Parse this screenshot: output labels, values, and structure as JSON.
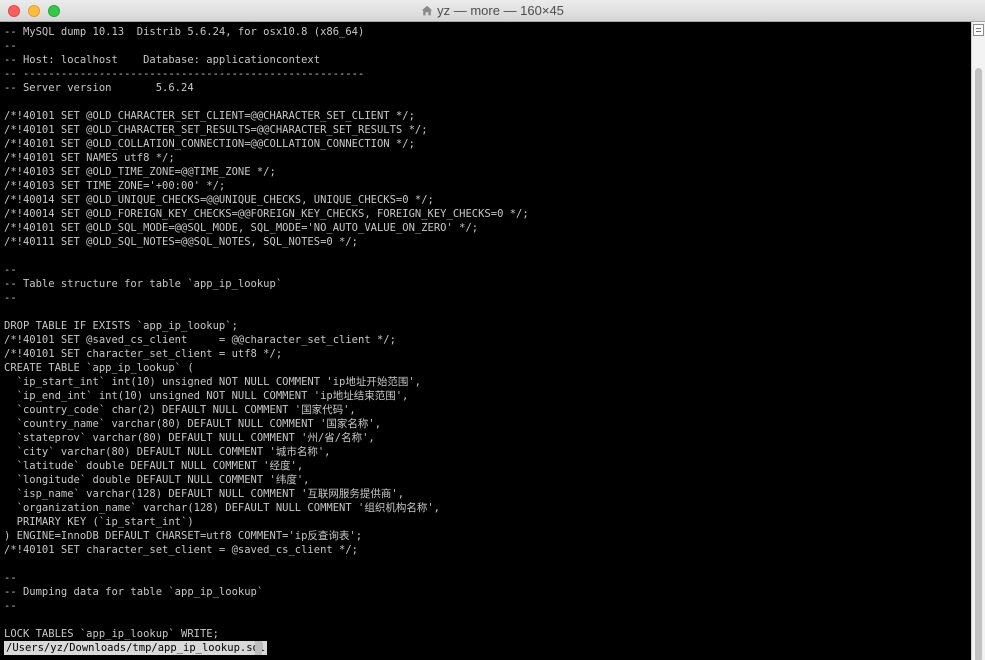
{
  "window": {
    "title": "yz — more — 160×45"
  },
  "terminal": {
    "lines": [
      "-- MySQL dump 10.13  Distrib 5.6.24, for osx10.8 (x86_64)",
      "--",
      "-- Host: localhost    Database: applicationcontext",
      "-- ------------------------------------------------------",
      "-- Server version       5.6.24",
      "",
      "/*!40101 SET @OLD_CHARACTER_SET_CLIENT=@@CHARACTER_SET_CLIENT */;",
      "/*!40101 SET @OLD_CHARACTER_SET_RESULTS=@@CHARACTER_SET_RESULTS */;",
      "/*!40101 SET @OLD_COLLATION_CONNECTION=@@COLLATION_CONNECTION */;",
      "/*!40101 SET NAMES utf8 */;",
      "/*!40103 SET @OLD_TIME_ZONE=@@TIME_ZONE */;",
      "/*!40103 SET TIME_ZONE='+00:00' */;",
      "/*!40014 SET @OLD_UNIQUE_CHECKS=@@UNIQUE_CHECKS, UNIQUE_CHECKS=0 */;",
      "/*!40014 SET @OLD_FOREIGN_KEY_CHECKS=@@FOREIGN_KEY_CHECKS, FOREIGN_KEY_CHECKS=0 */;",
      "/*!40101 SET @OLD_SQL_MODE=@@SQL_MODE, SQL_MODE='NO_AUTO_VALUE_ON_ZERO' */;",
      "/*!40111 SET @OLD_SQL_NOTES=@@SQL_NOTES, SQL_NOTES=0 */;",
      "",
      "--",
      "-- Table structure for table `app_ip_lookup`",
      "--",
      "",
      "DROP TABLE IF EXISTS `app_ip_lookup`;",
      "/*!40101 SET @saved_cs_client     = @@character_set_client */;",
      "/*!40101 SET character_set_client = utf8 */;",
      "CREATE TABLE `app_ip_lookup` (",
      "  `ip_start_int` int(10) unsigned NOT NULL COMMENT 'ip地址开始范围',",
      "  `ip_end_int` int(10) unsigned NOT NULL COMMENT 'ip地址结束范围',",
      "  `country_code` char(2) DEFAULT NULL COMMENT '国家代码',",
      "  `country_name` varchar(80) DEFAULT NULL COMMENT '国家名称',",
      "  `stateprov` varchar(80) DEFAULT NULL COMMENT '州/省/名称',",
      "  `city` varchar(80) DEFAULT NULL COMMENT '城市名称',",
      "  `latitude` double DEFAULT NULL COMMENT '经度',",
      "  `longitude` double DEFAULT NULL COMMENT '纬度',",
      "  `isp_name` varchar(128) DEFAULT NULL COMMENT '互联网服务提供商',",
      "  `organization_name` varchar(128) DEFAULT NULL COMMENT '组织机构名称',",
      "  PRIMARY KEY (`ip_start_int`)",
      ") ENGINE=InnoDB DEFAULT CHARSET=utf8 COMMENT='ip反查询表';",
      "/*!40101 SET character_set_client = @saved_cs_client */;",
      "",
      "--",
      "-- Dumping data for table `app_ip_lookup`",
      "--",
      "",
      "LOCK TABLES `app_ip_lookup` WRITE;"
    ],
    "status": "/Users/yz/Downloads/tmp/app_ip_lookup.sql"
  },
  "icons": {
    "title_icon": "home-folder-icon",
    "scroll_icon": "split-pane-icon"
  },
  "colors": {
    "terminal_bg": "#000000",
    "terminal_text": "#c7c7c7",
    "status_bg": "#d9d9d9"
  }
}
